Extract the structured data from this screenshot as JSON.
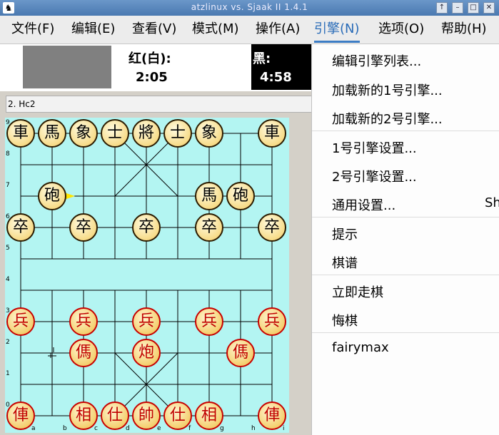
{
  "window": {
    "title": "atzlinux vs. Sjaak II 1.4.1"
  },
  "menubar": {
    "items": [
      {
        "label": "文件(F)"
      },
      {
        "label": "编辑(E)"
      },
      {
        "label": "查看(V)"
      },
      {
        "label": "模式(M)"
      },
      {
        "label": "操作(A)"
      },
      {
        "label": "引擎(N)"
      },
      {
        "label": "选项(O)"
      },
      {
        "label": "帮助(H)"
      }
    ],
    "active": "引擎(N)"
  },
  "clocks": {
    "white_label": "红(白):",
    "white_time": "2:05",
    "black_label": "黑:",
    "black_time": "4:58"
  },
  "movelist": {
    "text": "2. Hc2"
  },
  "board": {
    "rank_labels": [
      "9",
      "8",
      "7",
      "6",
      "5",
      "4",
      "3",
      "2",
      "1",
      "0"
    ],
    "file_labels": [
      "a",
      "b",
      "c",
      "d",
      "e",
      "f",
      "g",
      "h",
      "i"
    ],
    "black_back": [
      "車",
      "馬",
      "象",
      "士",
      "將",
      "士",
      "象",
      "馬",
      "車"
    ],
    "black_cannon_b": "砲",
    "black_horse_g": "馬",
    "black_cannon_h": "砲",
    "black_pawn": "卒",
    "red_pawn": "兵",
    "red_horse_c": "傌",
    "red_cannon_e": "炮",
    "red_horse_h": "傌",
    "red_back": [
      "俥",
      "相",
      "仕",
      "帥",
      "仕",
      "相",
      "俥"
    ]
  },
  "dropdown": {
    "items": [
      {
        "label": "编辑引擎列表..."
      },
      {
        "label": "加载新的1号引擎..."
      },
      {
        "label": "加载新的2号引擎..."
      },
      {
        "label": "1号引擎设置..."
      },
      {
        "label": "2号引擎设置..."
      },
      {
        "label": "通用设置..."
      },
      {
        "label": "提示"
      },
      {
        "label": "棋谱"
      },
      {
        "label": "立即走棋"
      },
      {
        "label": "悔棋"
      },
      {
        "label": "fairymax"
      }
    ],
    "shortcut_partial": "Sh"
  }
}
